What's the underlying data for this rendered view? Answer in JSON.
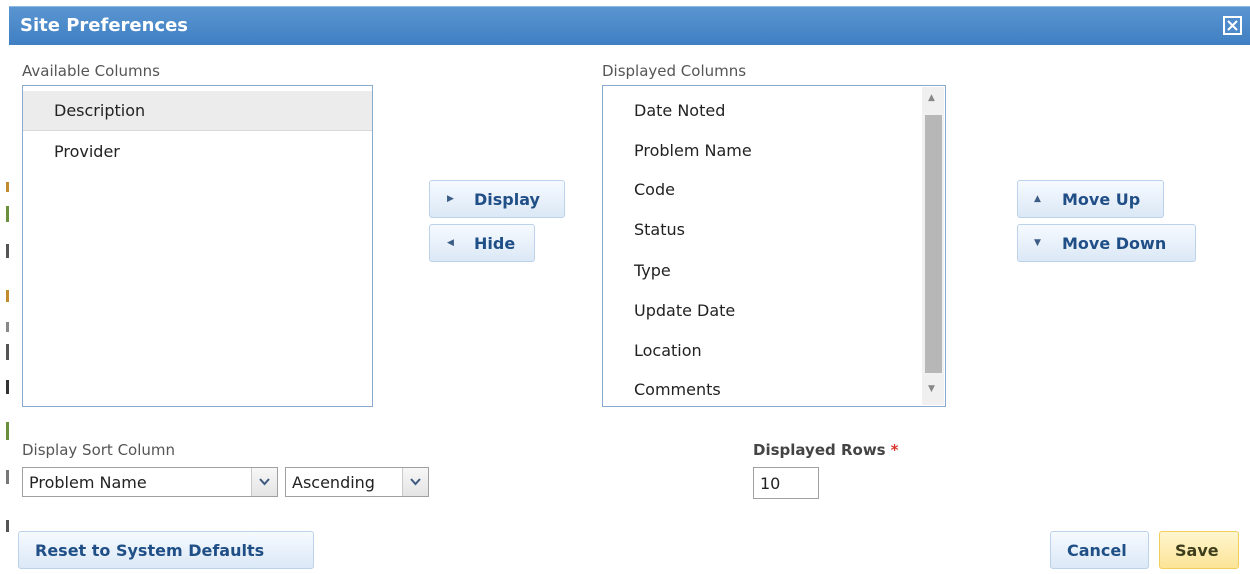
{
  "dialog": {
    "title": "Site Preferences"
  },
  "available_columns": {
    "label": "Available Columns",
    "items": [
      "Description",
      "Provider"
    ],
    "selected": "Description"
  },
  "displayed_columns": {
    "label": "Displayed Columns",
    "items": [
      "Date Noted",
      "Problem Name",
      "Code",
      "Status",
      "Type",
      "Update Date",
      "Location",
      "Comments"
    ]
  },
  "transfer_buttons": {
    "display": "Display",
    "hide": "Hide"
  },
  "order_buttons": {
    "move_up": "Move Up",
    "move_down": "Move Down"
  },
  "sort": {
    "label": "Display Sort Column",
    "column_value": "Problem Name",
    "direction_value": "Ascending"
  },
  "rows": {
    "label": "Displayed Rows",
    "required_mark": "*",
    "value": "10"
  },
  "footer": {
    "reset": "Reset to System Defaults",
    "cancel": "Cancel",
    "save": "Save"
  },
  "colors": {
    "titlebar": "#4a89c9",
    "button_text": "#1f4f86",
    "save_bg": "#fce497",
    "required": "#d9342b"
  },
  "icons": [
    "close-icon",
    "triangle-right-icon",
    "triangle-left-icon",
    "triangle-up-icon",
    "triangle-down-icon",
    "chevron-down-icon"
  ]
}
